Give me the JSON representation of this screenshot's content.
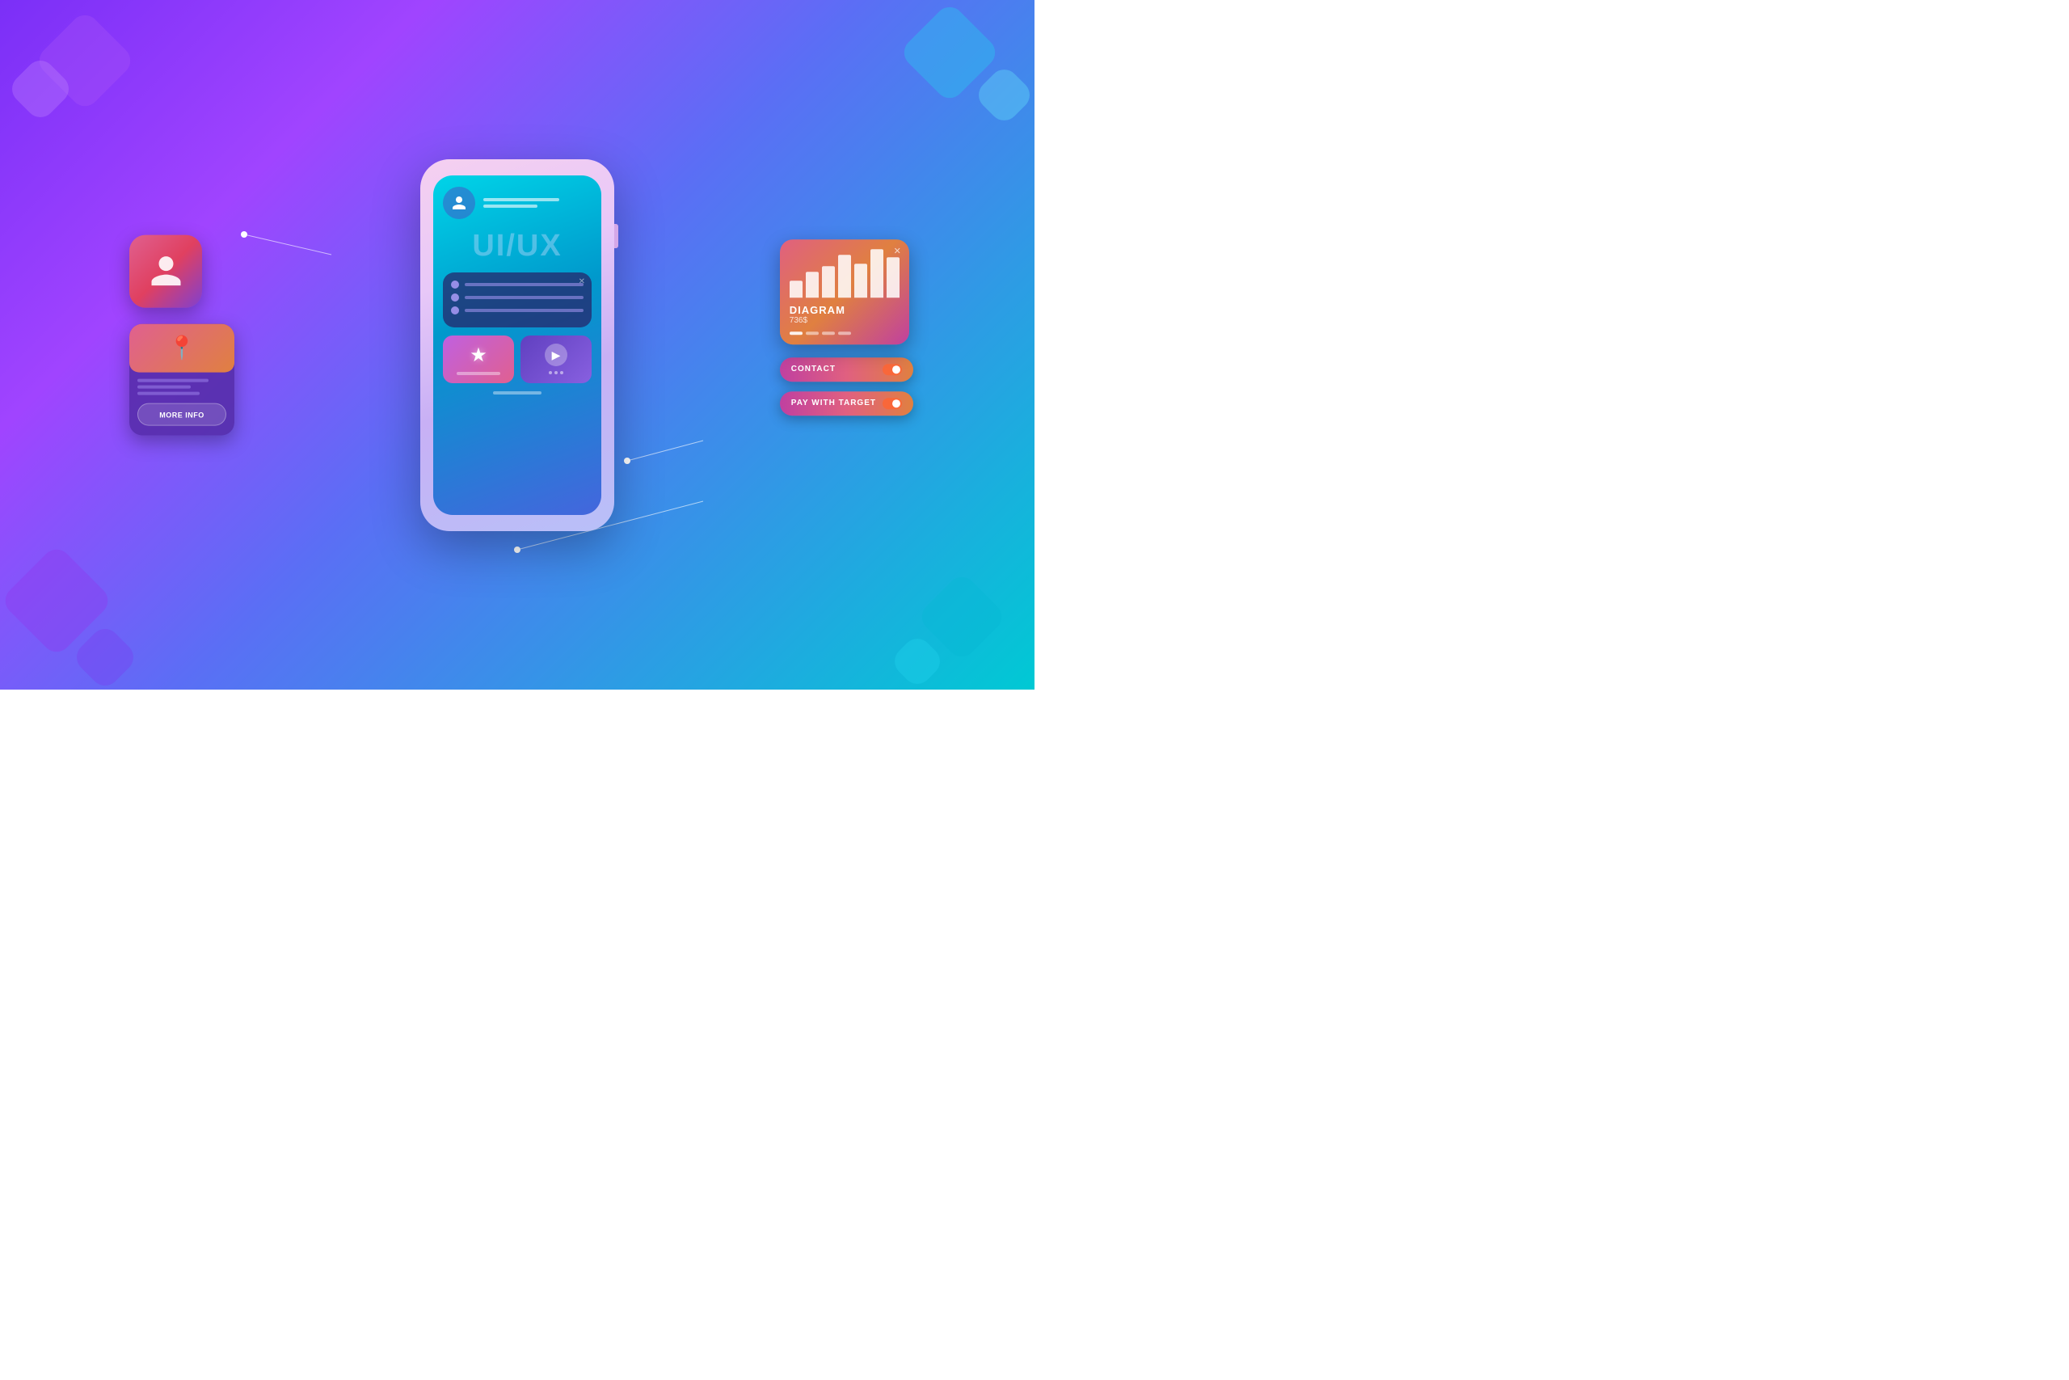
{
  "background": {
    "gradient_start": "#7b2ff7",
    "gradient_end": "#00c9d4"
  },
  "phone": {
    "uiux_label": "UI/UX",
    "indicator_visible": true
  },
  "left_cards": {
    "profile_card": {
      "alt": "Profile icon"
    },
    "info_card": {
      "map_pin": "📍",
      "lines": [
        {
          "width": "80%"
        },
        {
          "width": "60%"
        },
        {
          "width": "70%"
        }
      ],
      "more_info_label": "MORE INFO"
    }
  },
  "right_cards": {
    "diagram": {
      "close_btn": "✕",
      "title": "DIAGRAM",
      "value": "736$",
      "bars": [
        30,
        45,
        55,
        75,
        60,
        85,
        70
      ],
      "dots": [
        true,
        false,
        false,
        false
      ]
    },
    "contact_btn": {
      "label": "CONTACT",
      "toggle_on": true
    },
    "pay_btn": {
      "label": "PAY WITH TARGET",
      "toggle_on": true
    }
  },
  "list_card": {
    "close_btn": "✕",
    "items": [
      {
        "bar_width": "70%"
      },
      {
        "bar_width": "55%"
      },
      {
        "bar_width": "80%"
      }
    ]
  }
}
